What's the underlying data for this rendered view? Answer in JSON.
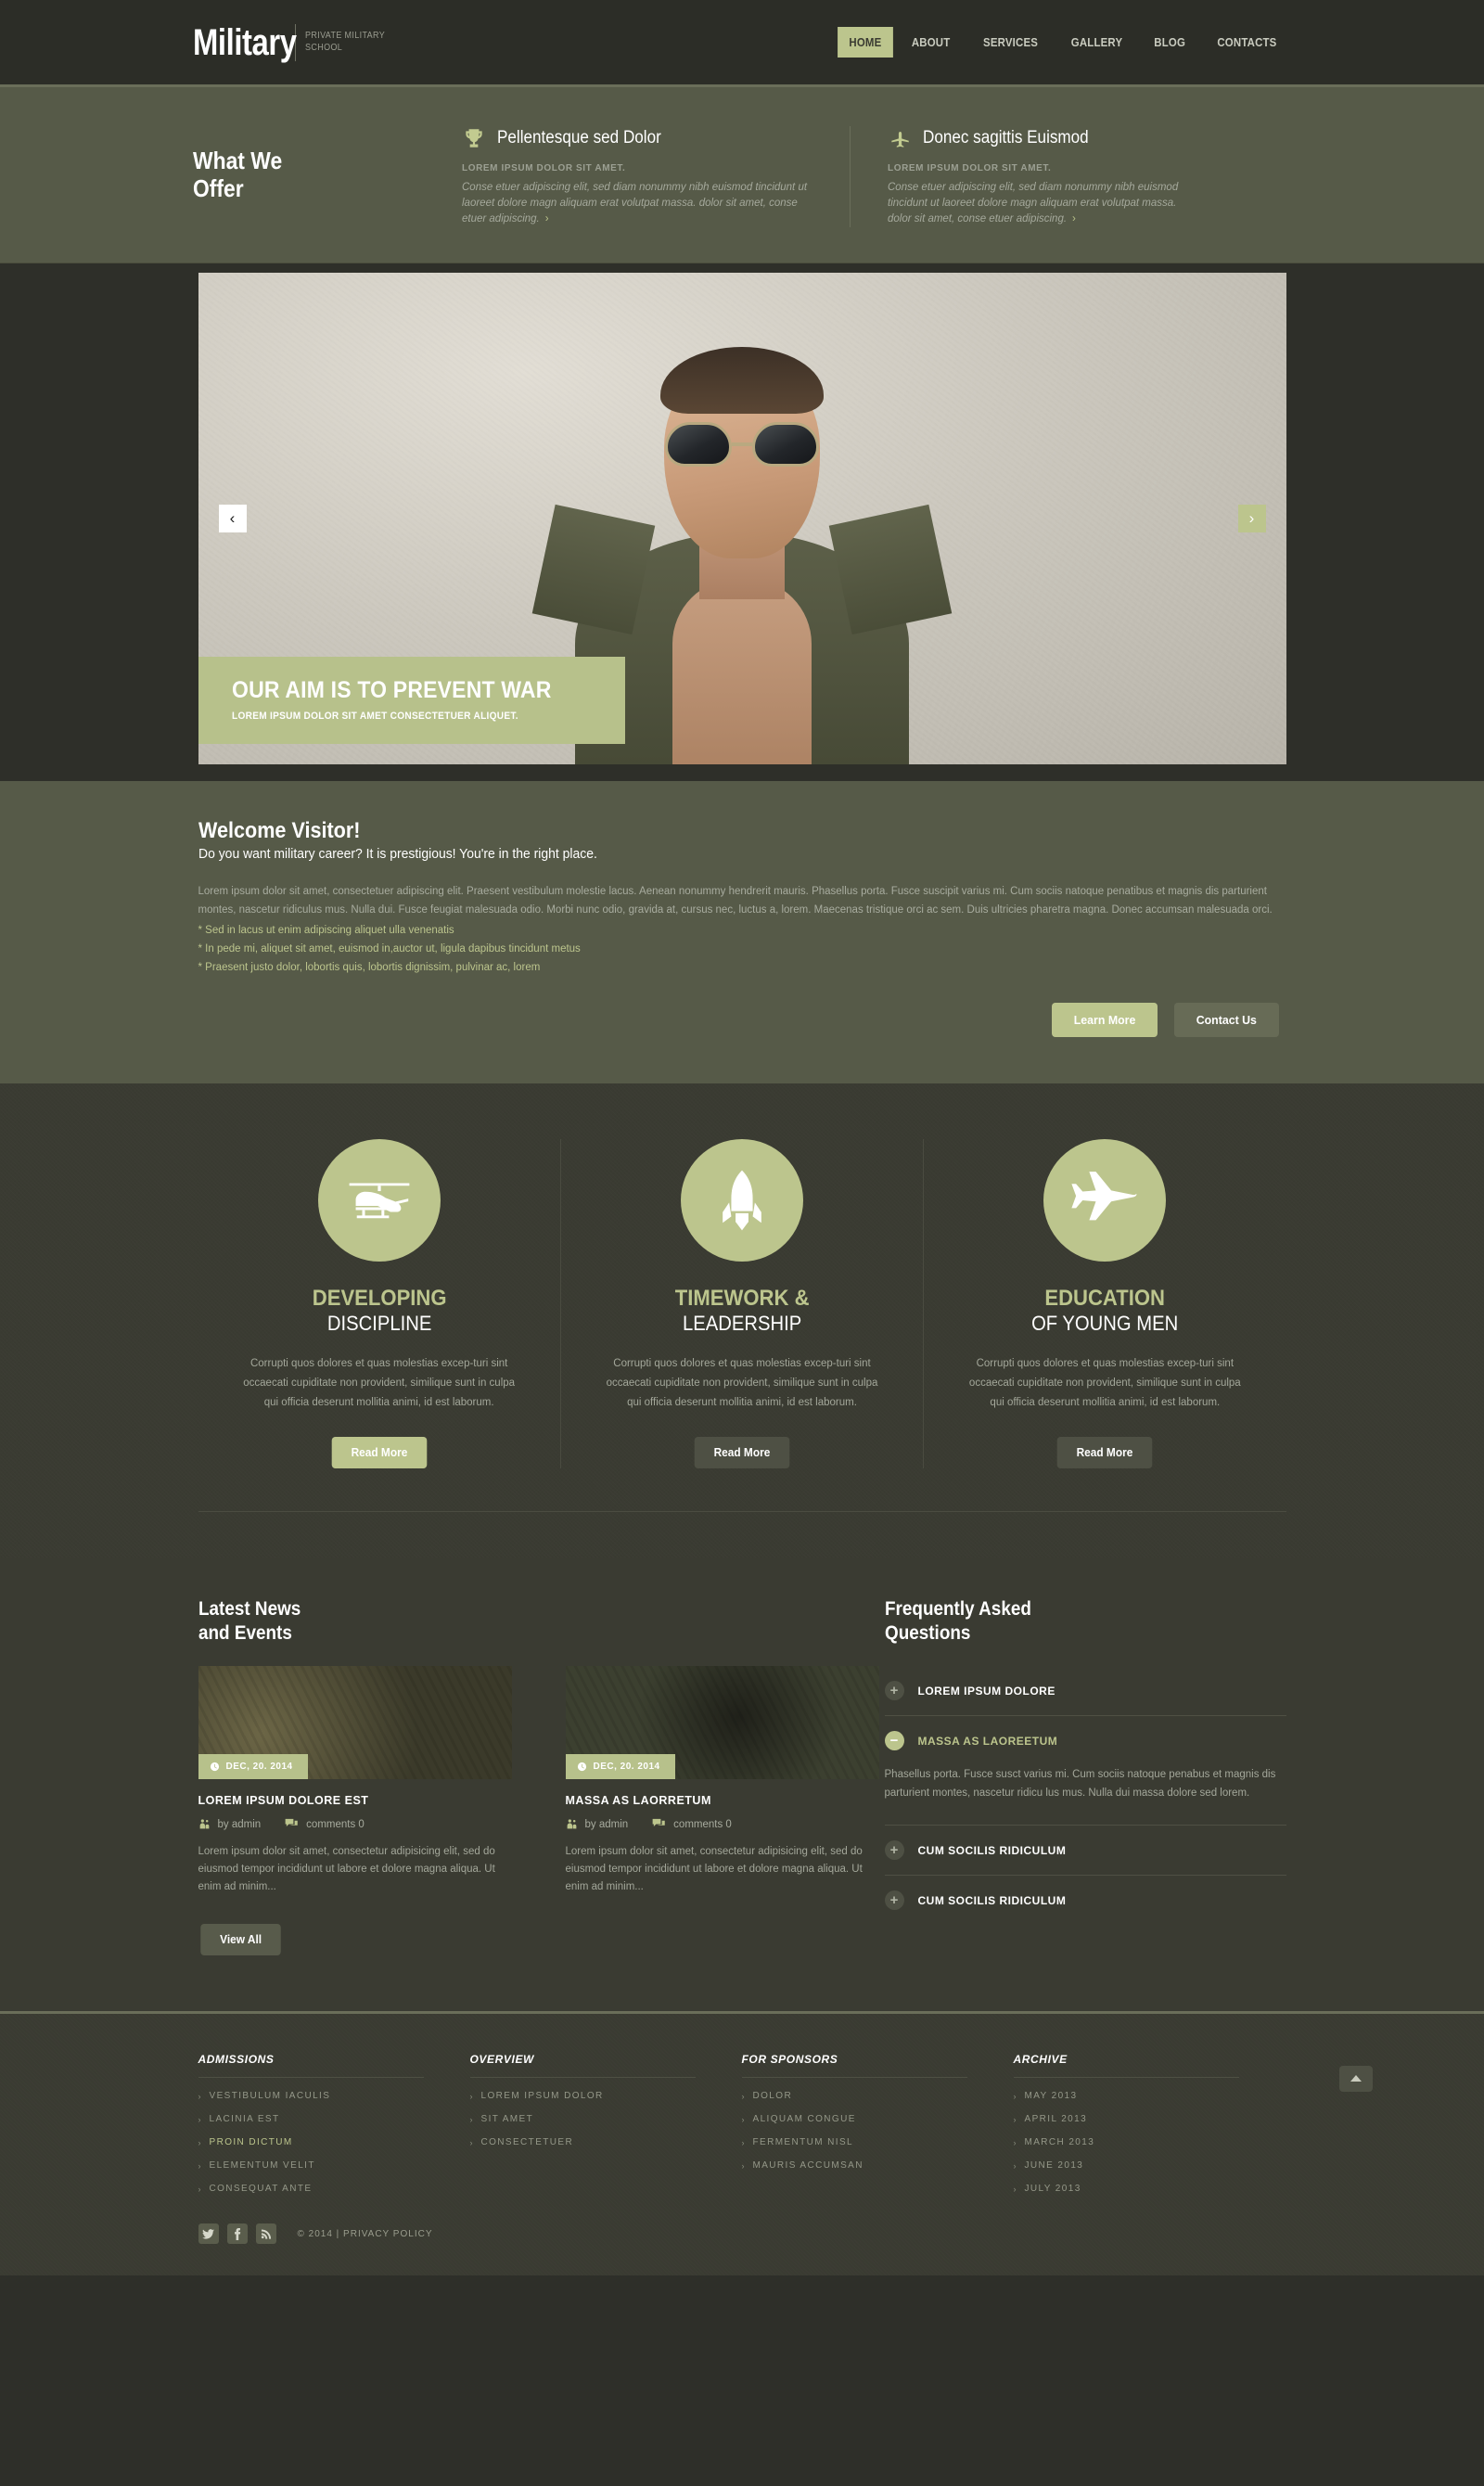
{
  "header": {
    "brand_name": "Military",
    "brand_tagline": "PRIVATE MILITARY\nSCHOOL",
    "nav": [
      {
        "label": "HOME",
        "active": true
      },
      {
        "label": "ABOUT",
        "active": false
      },
      {
        "label": "SERVICES",
        "active": false
      },
      {
        "label": "GALLERY",
        "active": false
      },
      {
        "label": "BLOG",
        "active": false
      },
      {
        "label": "CONTACTS",
        "active": false
      }
    ]
  },
  "offer": {
    "title": "What We\nOffer",
    "columns": [
      {
        "icon": "trophy-icon",
        "heading": "Pellentesque sed Dolor",
        "subheading": "LOREM IPSUM DOLOR SIT AMET.",
        "body": "Conse etuer adipiscing elit, sed diam nonummy nibh euismod tincidunt ut laoreet dolore magn aliquam erat volutpat massa. dolor sit amet, conse etuer adipiscing.",
        "arrow": "›"
      },
      {
        "icon": "airplane-icon",
        "heading": "Donec sagittis Euismod",
        "subheading": "LOREM IPSUM DOLOR SIT AMET.",
        "body": "Conse etuer adipiscing elit, sed diam nonummy nibh euismod tincidunt ut laoreet dolore magn aliquam erat volutpat massa. dolor sit amet, conse etuer adipiscing.",
        "arrow": "›"
      }
    ]
  },
  "slider": {
    "prev": "‹",
    "next": "›",
    "caption_title": "OUR AIM IS TO PREVENT WAR",
    "caption_sub": "LOREM IPSUM DOLOR SIT AMET CONSECTETUER ALIQUET."
  },
  "welcome": {
    "title": "Welcome Visitor!",
    "subtitle": "Do you want military career? It is prestigious! You're in the right place.",
    "paragraph": "Lorem ipsum dolor sit amet, consectetuer adipiscing elit. Praesent vestibulum molestie lacus. Aenean nonummy hendrerit mauris. Phasellus porta. Fusce suscipit varius mi. Cum sociis natoque penatibus et magnis dis parturient montes, nascetur ridiculus mus. Nulla dui. Fusce feugiat malesuada odio. Morbi nunc odio, gravida at, cursus nec, luctus a, lorem. Maecenas tristique orci ac sem. Duis ultricies pharetra magna. Donec accumsan malesuada orci.",
    "bullets": [
      "* Sed in lacus ut enim adipiscing aliquet ulla venenatis",
      "* In pede mi, aliquet sit amet, euismod in,auctor ut, ligula dapibus tincidunt metus",
      "* Praesent justo dolor, lobortis quis, lobortis dignissim, pulvinar ac, lorem"
    ],
    "btn_primary": "Learn More",
    "btn_secondary": "Contact Us"
  },
  "features": [
    {
      "icon": "helicopter-icon",
      "title": "DEVELOPING",
      "subtitle": "DISCIPLINE",
      "text": "Corrupti quos dolores et quas molestias excep-turi sint occaecati cupiditate non provident, similique sunt in culpa qui officia deserunt mollitia animi, id est laborum.",
      "button": "Read More",
      "button_style": "primary"
    },
    {
      "icon": "rocket-icon",
      "title": "TIMEWORK &",
      "subtitle": "LEADERSHIP",
      "text": "Corrupti quos dolores et quas molestias excep-turi sint occaecati cupiditate non provident, similique sunt in culpa qui officia deserunt mollitia animi, id est laborum.",
      "button": "Read More",
      "button_style": "dark"
    },
    {
      "icon": "jet-icon",
      "title": "EDUCATION",
      "subtitle": "OF YOUNG MEN",
      "text": "Corrupti quos dolores et quas molestias excep-turi sint occaecati cupiditate non provident, similique sunt in culpa qui officia deserunt mollitia animi, id est laborum.",
      "button": "Read More",
      "button_style": "dark"
    }
  ],
  "news": {
    "title": "Latest News\nand Events",
    "items": [
      {
        "date": "DEC, 20. 2014",
        "title": "LOREM IPSUM DOLORE EST",
        "author": "by admin",
        "comments": "comments 0",
        "text": "Lorem ipsum dolor sit amet, consectetur adipisicing elit, sed do eiusmod tempor incididunt ut labore et dolore magna aliqua. Ut enim ad minim..."
      },
      {
        "date": "DEC, 20. 2014",
        "title": "MASSA AS LAORRETUM",
        "author": "by admin",
        "comments": "comments 0",
        "text": "Lorem ipsum dolor sit amet, consectetur adipisicing elit, sed do eiusmod tempor incididunt ut labore et dolore magna aliqua. Ut enim ad minim..."
      }
    ],
    "view_all": "View All"
  },
  "faq": {
    "title": "Frequently Asked\nQuestions",
    "items": [
      {
        "label": "LOREM IPSUM DOLORE",
        "open": false,
        "icon": "plus-icon",
        "answer": ""
      },
      {
        "label": "MASSA AS LAOREETUM",
        "open": true,
        "icon": "minus-icon",
        "answer": "Phasellus porta. Fusce susct varius mi. Cum sociis natoque penabus et magnis dis parturient montes, nascetur ridicu lus mus. Nulla dui massa dolore sed lorem."
      },
      {
        "label": "CUM SOCILIS RIDICULUM",
        "open": false,
        "icon": "plus-icon",
        "answer": ""
      },
      {
        "label": "CUM SOCILIS RIDICULUM",
        "open": false,
        "icon": "plus-icon",
        "answer": ""
      }
    ]
  },
  "footer": {
    "columns": [
      {
        "heading": "ADMISSIONS",
        "links": [
          {
            "label": "VESTIBULUM IACULIS",
            "highlight": false
          },
          {
            "label": "LACINIA EST",
            "highlight": false
          },
          {
            "label": "PROIN DICTUM",
            "highlight": true
          },
          {
            "label": "ELEMENTUM VELIT",
            "highlight": false
          },
          {
            "label": "CONSEQUAT ANTE",
            "highlight": false
          }
        ]
      },
      {
        "heading": "OVERVIEW",
        "links": [
          {
            "label": "LOREM IPSUM DOLOR",
            "highlight": false
          },
          {
            "label": "SIT AMET",
            "highlight": false
          },
          {
            "label": "CONSECTETUER",
            "highlight": false
          }
        ]
      },
      {
        "heading": "FOR SPONSORS",
        "links": [
          {
            "label": "DOLOR",
            "highlight": false
          },
          {
            "label": "ALIQUAM CONGUE",
            "highlight": false
          },
          {
            "label": "FERMENTUM NISL",
            "highlight": false
          },
          {
            "label": "MAURIS ACCUMSAN",
            "highlight": false
          }
        ]
      },
      {
        "heading": "ARCHIVE",
        "links": [
          {
            "label": "MAY 2013",
            "highlight": false
          },
          {
            "label": "APRIL 2013",
            "highlight": false
          },
          {
            "label": "MARCH 2013",
            "highlight": false
          },
          {
            "label": "JUNE 2013",
            "highlight": false
          },
          {
            "label": "JULY 2013",
            "highlight": false
          }
        ]
      }
    ],
    "social": [
      "twitter-icon",
      "facebook-icon",
      "rss-icon"
    ],
    "copyright": "© 2014 | PRIVACY POLICY",
    "chevron": "›"
  },
  "colors": {
    "accent": "#bcc58d",
    "dark": "#2c2d27",
    "panel": "#565a48",
    "body": "#3a3b32"
  }
}
